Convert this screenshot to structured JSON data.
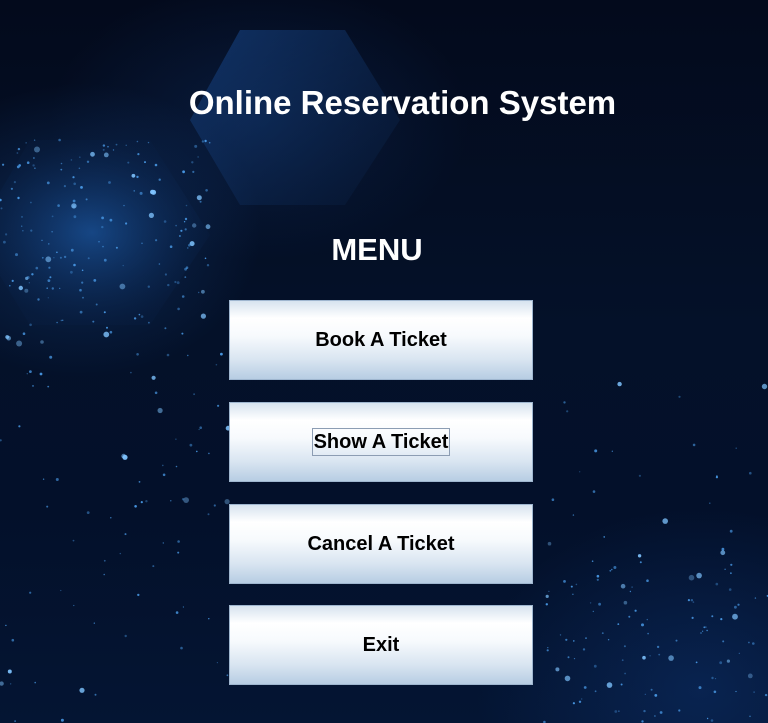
{
  "app": {
    "title": "Online Reservation System"
  },
  "menu": {
    "heading": "MENU",
    "buttons": [
      {
        "id": "book",
        "label": "Book A Ticket"
      },
      {
        "id": "show",
        "label": "Show A Ticket",
        "focused": true
      },
      {
        "id": "cancel",
        "label": "Cancel A Ticket"
      },
      {
        "id": "exit",
        "label": "Exit"
      }
    ]
  },
  "colors": {
    "background": "#02081a",
    "title_text": "#ffffff",
    "button_text": "#000000",
    "button_top": "#ffffff",
    "button_bottom": "#b7cde3",
    "glow": "#3b8fe6"
  },
  "background": {
    "image": "dark-blue-tech-hexagon-particles"
  }
}
